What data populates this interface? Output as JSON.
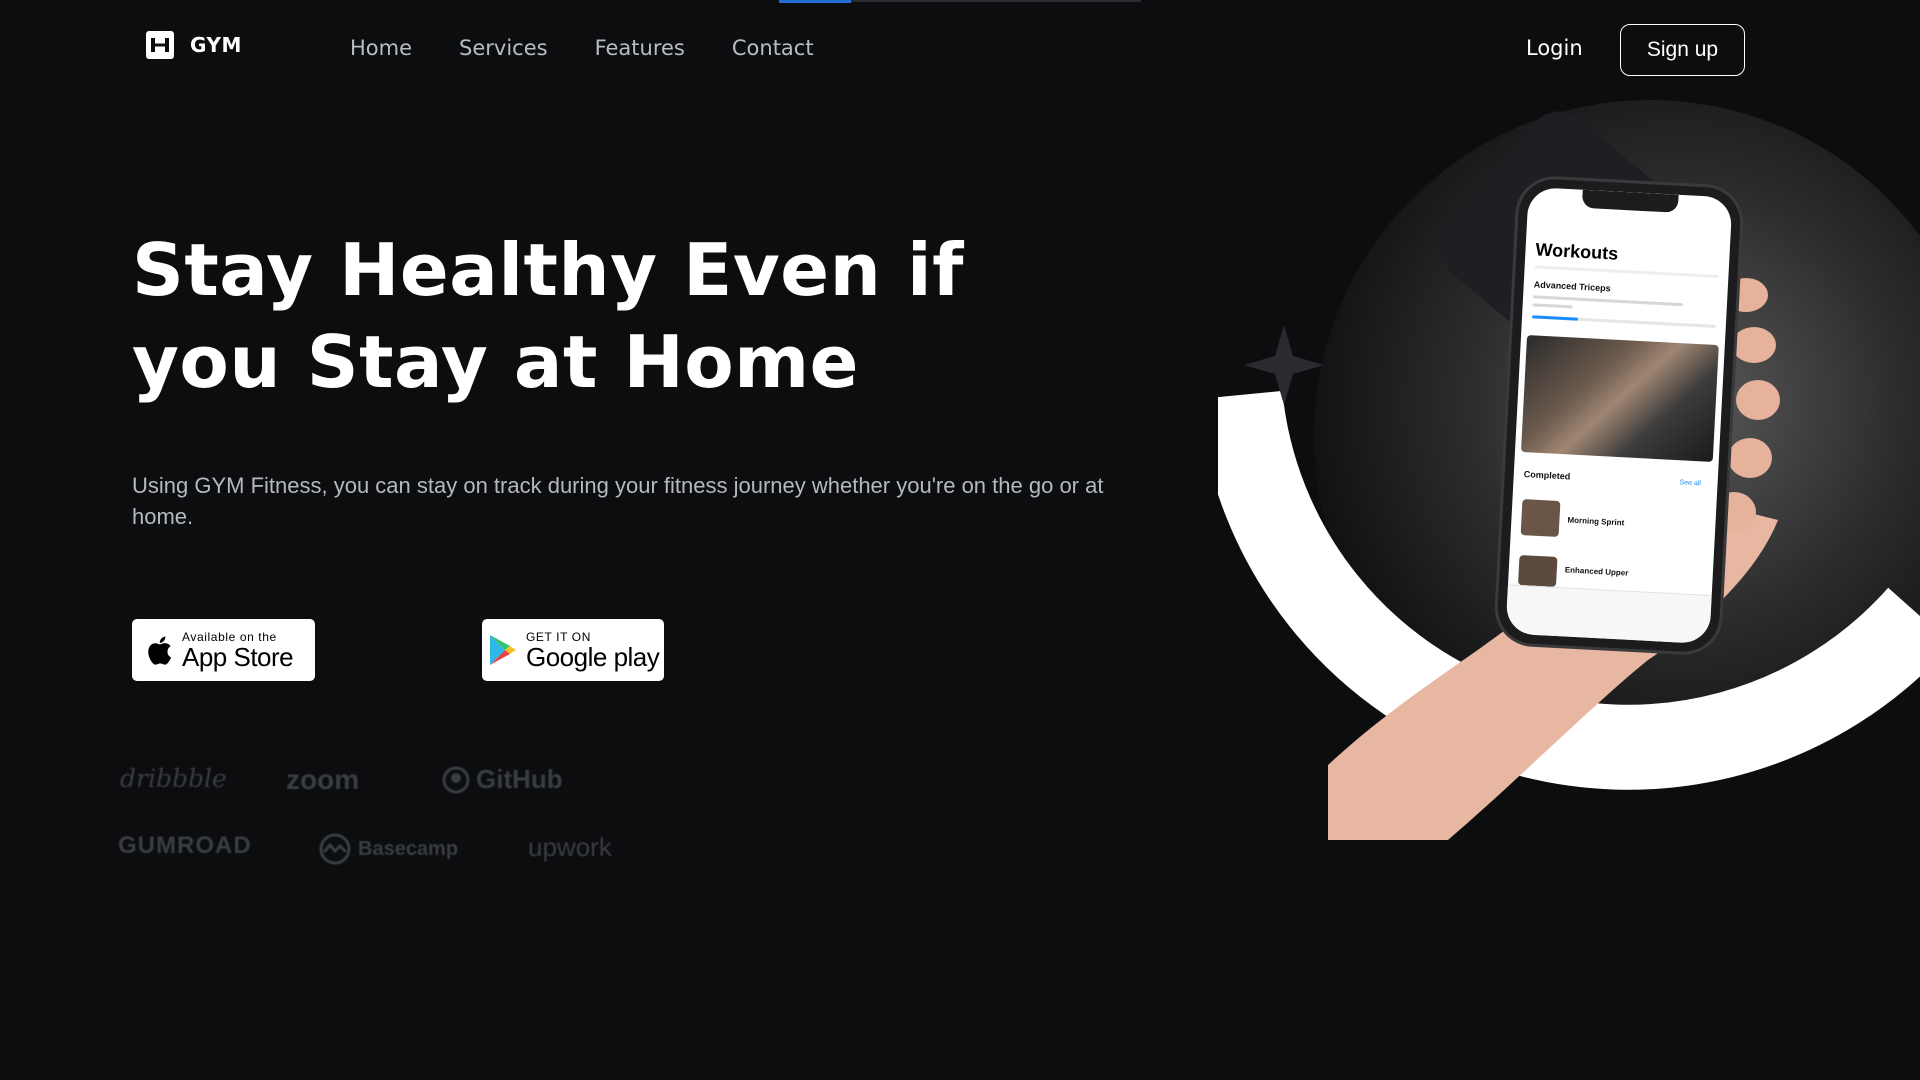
{
  "brand": {
    "logo_text": "GYM"
  },
  "nav": {
    "items": [
      {
        "label": "Home"
      },
      {
        "label": "Services"
      },
      {
        "label": "Features"
      },
      {
        "label": "Contact"
      }
    ]
  },
  "auth": {
    "login_label": "Login",
    "signup_label": "Sign up"
  },
  "hero": {
    "title": "Stay Healthy Even if you Stay at Home",
    "description": "Using GYM Fitness, you can stay on track during your fitness journey whether you're on the go or at home."
  },
  "stores": {
    "appstore": {
      "small": "Available on the",
      "big": "App Store"
    },
    "googleplay": {
      "small": "GET IT ON",
      "big": "Google play"
    }
  },
  "partners": [
    "dribbble",
    "zoom",
    "GitHub",
    "GUMROAD",
    "Basecamp",
    "upwork"
  ],
  "phone_screen": {
    "title": "Workouts",
    "workout_name": "Advanced Triceps",
    "section_label": "Completed",
    "see_all": "See all",
    "item1": "Morning Sprint",
    "item2": "Enhanced Upper"
  },
  "colors": {
    "background": "#0c0d0f",
    "accent_blue": "#1f6fd6",
    "nav_text": "#b9bcc3",
    "partner_logo": "#3a3d43"
  }
}
